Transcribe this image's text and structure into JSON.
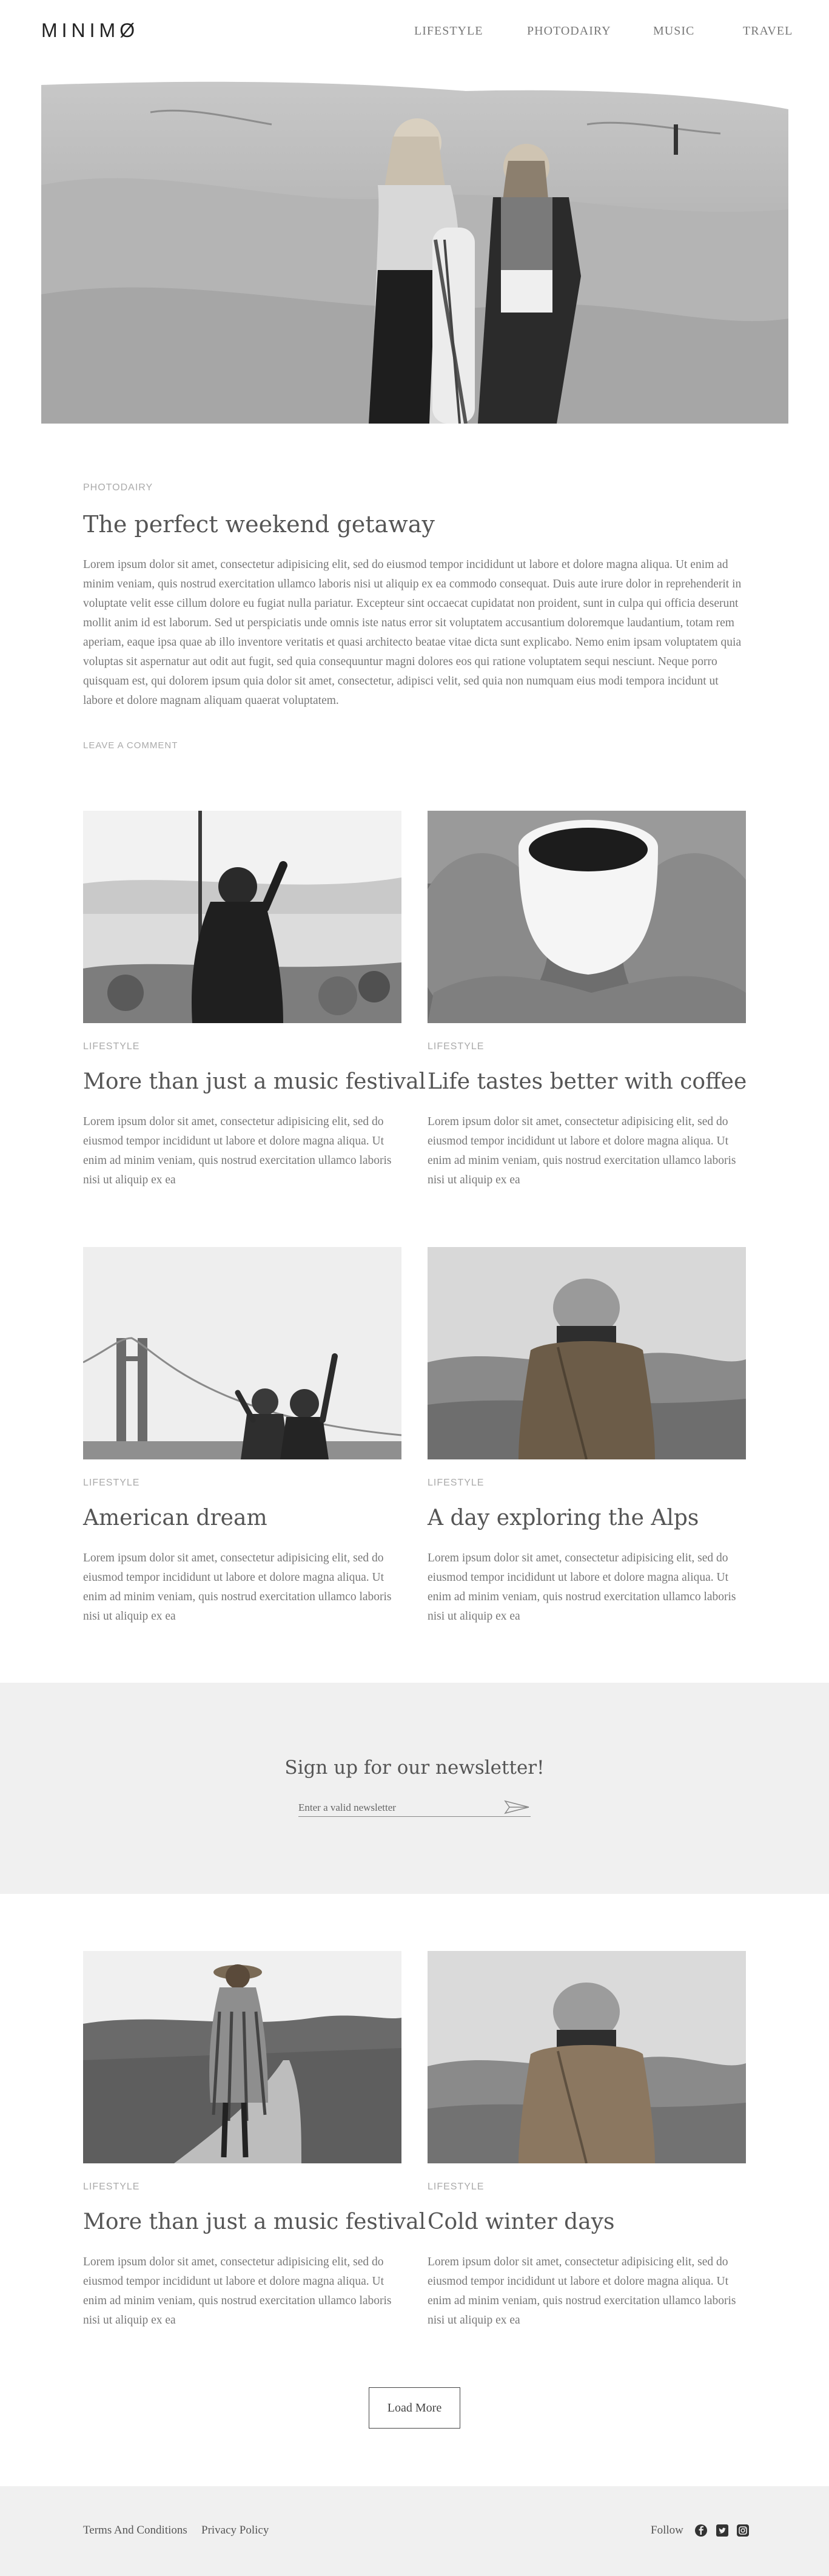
{
  "header": {
    "logo": "MINIMØ",
    "nav": [
      "LIFESTYLE",
      "PHOTODAIRY",
      "MUSIC",
      "TRAVEL"
    ]
  },
  "featured": {
    "category": "PHOTODAIRY",
    "title": "The perfect weekend getaway",
    "body": "Lorem ipsum dolor sit amet, consectetur adipisicing elit, sed do eiusmod tempor incididunt ut labore et dolore magna aliqua. Ut enim ad minim veniam, quis nostrud exercitation ullamco laboris nisi ut aliquip ex ea commodo consequat. Duis aute irure dolor in reprehenderit in voluptate velit esse cillum dolore eu fugiat nulla pariatur. Excepteur sint occaecat cupidatat non proident, sunt in culpa qui officia deserunt mollit anim id est laborum. Sed ut perspiciatis unde omnis iste natus error sit voluptatem accusantium doloremque laudantium, totam rem aperiam, eaque ipsa quae ab illo inventore veritatis et quasi architecto beatae vitae dicta sunt explicabo. Nemo enim ipsam voluptatem quia voluptas sit aspernatur aut odit aut fugit, sed quia consequuntur magni dolores eos qui ratione voluptatem sequi nesciunt. Neque porro quisquam est, qui dolorem ipsum quia dolor sit amet, consectetur, adipisci velit, sed quia non numquam eius modi tempora incidunt ut labore et dolore magnam aliquam quaerat voluptatem.",
    "link": "LEAVE A COMMENT"
  },
  "posts": [
    {
      "category": "LIFESTYLE",
      "title": "More than just a music festival",
      "body": "Lorem ipsum dolor sit amet, consectetur adipisicing elit, sed do eiusmod tempor incididunt ut labore et dolore magna aliqua. Ut enim ad minim veniam, quis nostrud exercitation ullamco laboris nisi ut aliquip ex ea"
    },
    {
      "category": "LIFESTYLE",
      "title": "Life tastes better with coffee",
      "body": "Lorem ipsum dolor sit amet, consectetur adipisicing elit, sed do eiusmod tempor incididunt ut labore et dolore magna aliqua. Ut enim ad minim veniam, quis nostrud exercitation ullamco laboris nisi ut aliquip ex ea"
    },
    {
      "category": "LIFESTYLE",
      "title": "American dream",
      "body": "Lorem ipsum dolor sit amet, consectetur adipisicing elit, sed do eiusmod tempor incididunt ut labore et dolore magna aliqua. Ut enim ad minim veniam, quis nostrud exercitation ullamco laboris nisi ut aliquip ex ea"
    },
    {
      "category": "LIFESTYLE",
      "title": "A day exploring the Alps",
      "body": "Lorem ipsum dolor sit amet, consectetur adipisicing elit, sed do eiusmod tempor incididunt ut labore et dolore magna aliqua. Ut enim ad minim veniam, quis nostrud exercitation ullamco laboris nisi ut aliquip ex ea"
    },
    {
      "category": "LIFESTYLE",
      "title": "More than just a music festival",
      "body": "Lorem ipsum dolor sit amet, consectetur adipisicing elit, sed do eiusmod tempor incididunt ut labore et dolore magna aliqua. Ut enim ad minim veniam, quis nostrud exercitation ullamco laboris nisi ut aliquip ex ea"
    },
    {
      "category": "LIFESTYLE",
      "title": "Cold winter days",
      "body": "Lorem ipsum dolor sit amet, consectetur adipisicing elit, sed do eiusmod tempor incididunt ut labore et dolore magna aliqua. Ut enim ad minim veniam, quis nostrud exercitation ullamco laboris nisi ut aliquip ex ea"
    }
  ],
  "newsletter": {
    "title": "Sign up for our newsletter!",
    "placeholder": "Enter a valid newsletter"
  },
  "load_more": "Load More",
  "footer": {
    "links": [
      "Terms And Conditions",
      "Privacy Policy"
    ],
    "follow": "Follow",
    "social_icons": [
      "facebook-icon",
      "twitter-icon",
      "instagram-icon"
    ]
  }
}
